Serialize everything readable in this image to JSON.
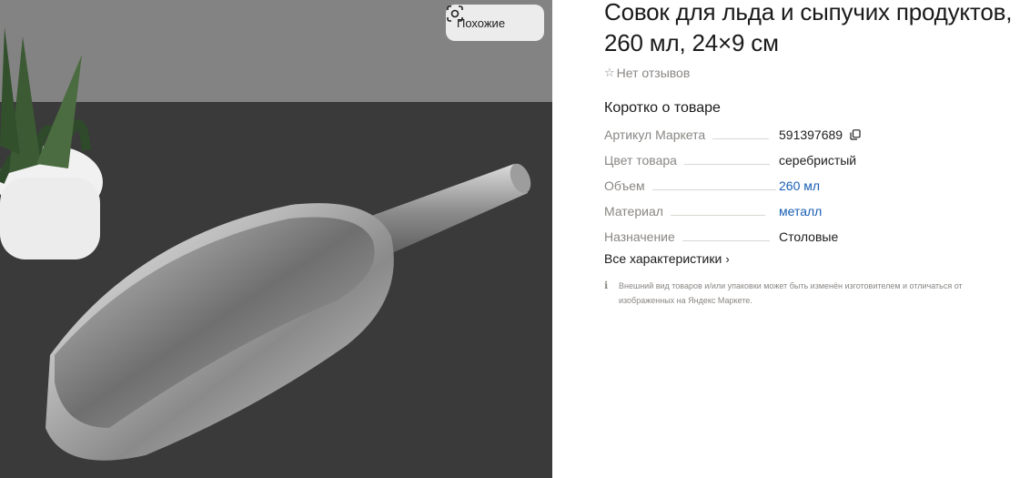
{
  "photo": {
    "alt_icon": "product-photo",
    "similar_label": "Похожие"
  },
  "product": {
    "title": "Совок для льда и сыпучих продуктов, 260 мл, 24×9 см",
    "reviews": "Нет отзывов"
  },
  "summary": {
    "heading": "Коротко о товаре",
    "specs": [
      {
        "name": "Артикул Маркета",
        "value": "591397689",
        "copyable": true
      },
      {
        "name": "Цвет товара",
        "value": "серебристый"
      },
      {
        "name": "Объем",
        "value": "260 мл",
        "link": true
      },
      {
        "name": "Материал",
        "value": "металл",
        "link": true
      },
      {
        "name": "Назначение",
        "value": "Столовые"
      }
    ],
    "all_specs_label": "Все характеристики"
  },
  "disclaimer": "Внешний вид товаров и/или упаковки может быть изменён изготовителем и отличаться от изображенных на Яндекс Маркете.",
  "colors": {
    "link": "#1a5fb4",
    "muted": "#8a8784"
  }
}
